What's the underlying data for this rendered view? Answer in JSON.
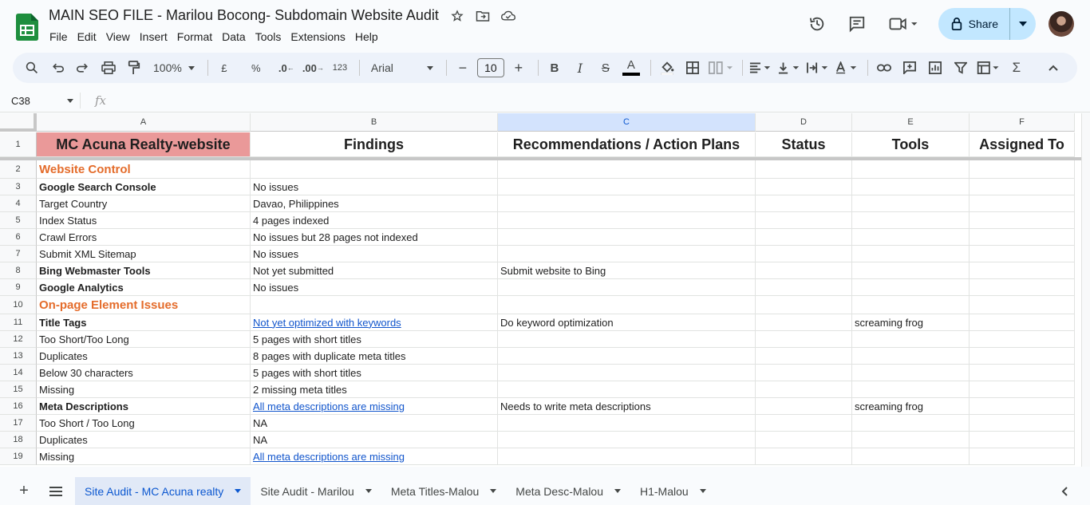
{
  "doc": {
    "title": "MAIN SEO FILE - Marilou Bocong- Subdomain Website Audit",
    "menus": [
      "File",
      "Edit",
      "View",
      "Insert",
      "Format",
      "Data",
      "Tools",
      "Extensions",
      "Help"
    ],
    "share_label": "Share"
  },
  "toolbar": {
    "zoom": "100%",
    "currency": "£",
    "percent": "%",
    "dec_minus": ".0",
    "dec_plus": ".00",
    "number_format": "123",
    "font": "Arial",
    "font_size": "10",
    "minus": "−",
    "plus": "+",
    "bold": "B",
    "italic": "I",
    "strike": "S",
    "text_color": "A",
    "sigma": "Σ"
  },
  "formula_bar": {
    "name_box": "C38",
    "fx": "fx"
  },
  "columns": [
    "A",
    "B",
    "C",
    "D",
    "E",
    "F"
  ],
  "rows": [
    {
      "num": "1",
      "a": "MC Acuna Realty-website",
      "b": "Findings",
      "c": "Recommendations / Action Plans",
      "d": "Status",
      "e": "Tools",
      "f": "Assigned To"
    },
    {
      "num": "2",
      "a": "Website Control",
      "b": "",
      "c": "",
      "e": ""
    },
    {
      "num": "3",
      "a": "Google Search Console",
      "b": "No issues",
      "c": "",
      "e": ""
    },
    {
      "num": "4",
      "a": "Target Country",
      "b": "Davao, Philippines",
      "c": "",
      "e": ""
    },
    {
      "num": "5",
      "a": "Index Status",
      "b": "4 pages indexed",
      "c": "",
      "e": ""
    },
    {
      "num": "6",
      "a": "Crawl Errors",
      "b": "No issues but 28 pages not indexed",
      "c": "",
      "e": ""
    },
    {
      "num": "7",
      "a": "Submit XML Sitemap",
      "b": "No issues",
      "c": "",
      "e": ""
    },
    {
      "num": "8",
      "a": "Bing Webmaster Tools",
      "b": "Not yet submitted",
      "c": "Submit website to Bing",
      "e": ""
    },
    {
      "num": "9",
      "a": "Google Analytics",
      "b": "No issues",
      "c": "",
      "e": ""
    },
    {
      "num": "10",
      "a": "On-page Element Issues",
      "b": "",
      "c": "",
      "e": ""
    },
    {
      "num": "11",
      "a": "Title Tags",
      "b": "Not yet optimized with keywords",
      "c": "Do keyword optimization",
      "e": "screaming frog"
    },
    {
      "num": "12",
      "a": "Too Short/Too Long",
      "b": "5 pages with short titles",
      "c": "",
      "e": ""
    },
    {
      "num": "13",
      "a": "Duplicates",
      "b": "8 pages with duplicate meta titles",
      "c": "",
      "e": ""
    },
    {
      "num": "14",
      "a": "Below 30 characters",
      "b": "5 pages with short titles",
      "c": "",
      "e": ""
    },
    {
      "num": "15",
      "a": "Missing",
      "b": "2 missing meta titles",
      "c": "",
      "e": ""
    },
    {
      "num": "16",
      "a": "Meta Descriptions",
      "b": "All meta descriptions are missing",
      "c": "Needs to write meta descriptions",
      "e": "screaming frog"
    },
    {
      "num": "17",
      "a": "Too Short / Too Long",
      "b": "NA",
      "c": "",
      "e": ""
    },
    {
      "num": "18",
      "a": "Duplicates",
      "b": "NA",
      "c": "",
      "e": ""
    },
    {
      "num": "19",
      "a": "Missing",
      "b": "All meta descriptions are missing",
      "c": "",
      "e": ""
    }
  ],
  "sheets": [
    "Site Audit - MC Acuna realty",
    "Site Audit - Marilou",
    "Meta Titles-Malou",
    "Meta Desc-Malou",
    "H1-Malou"
  ],
  "colors": {
    "header_a_bg": "#ea9999",
    "section_text": "#e46c2b",
    "link": "#1155cc",
    "selected_col": "#d3e3fd",
    "share_bg": "#c2e7ff"
  }
}
